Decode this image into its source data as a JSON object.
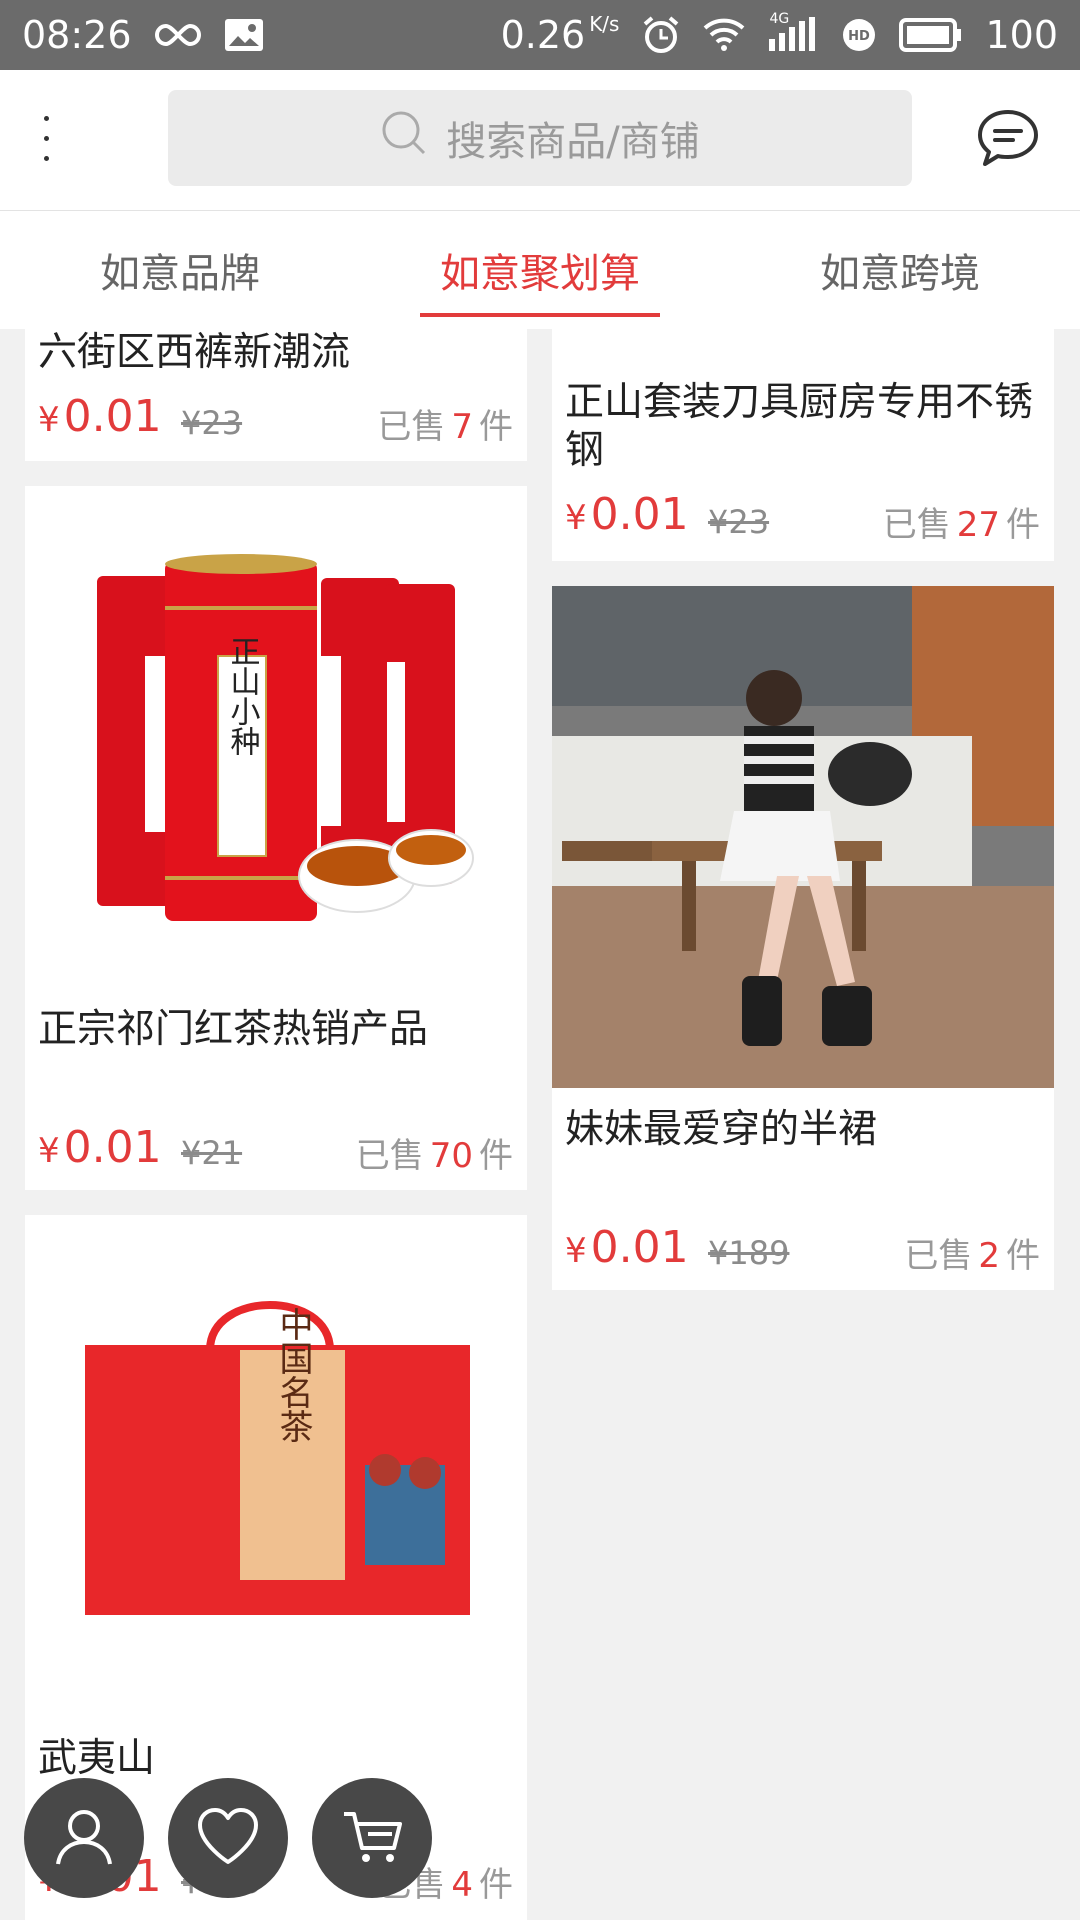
{
  "status_bar": {
    "time": "08:26",
    "speed_value": "0.26",
    "speed_unit": "K/s",
    "network": "4G",
    "battery": "100",
    "icons": [
      "infinity-icon",
      "image-icon",
      "alarm-icon",
      "wifi-icon",
      "signal-icon",
      "hd-icon",
      "battery-icon"
    ]
  },
  "header": {
    "search_placeholder": "搜索商品/商铺",
    "icons": [
      "menu-icon",
      "search-icon",
      "message-icon"
    ]
  },
  "tabs": [
    {
      "label": "如意品牌",
      "active": false
    },
    {
      "label": "如意聚划算",
      "active": true
    },
    {
      "label": "如意跨境",
      "active": false
    }
  ],
  "products": [
    {
      "title": "六街区西裤新潮流",
      "price": "0.01",
      "currency": "¥",
      "old_price": "¥23",
      "sold_prefix": "已售",
      "sold_count": "7",
      "sold_suffix": "件"
    },
    {
      "title": "正山套装刀具厨房专用不锈钢",
      "price": "0.01",
      "currency": "¥",
      "old_price": "¥23",
      "sold_prefix": "已售",
      "sold_count": "27",
      "sold_suffix": "件"
    },
    {
      "title": "正宗祁门红茶热销产品",
      "price": "0.01",
      "currency": "¥",
      "old_price": "¥21",
      "sold_prefix": "已售",
      "sold_count": "70",
      "sold_suffix": "件"
    },
    {
      "title": "妹妹最爱穿的半裙",
      "price": "0.01",
      "currency": "¥",
      "old_price": "¥189",
      "sold_prefix": "已售",
      "sold_count": "2",
      "sold_suffix": "件"
    },
    {
      "title": "武夷山",
      "price": "0.01",
      "currency": "¥",
      "old_price": "¥239",
      "sold_prefix": "已售",
      "sold_count": "4",
      "sold_suffix": "件"
    }
  ],
  "image_text": {
    "tea_can": "正山小种",
    "gift_box": "中国名茶"
  },
  "floating_buttons": [
    "user-icon",
    "heart-icon",
    "cart-icon"
  ],
  "colors": {
    "accent": "#e23b3b",
    "status_bar": "#6b6b6b",
    "fab": "#484848"
  }
}
